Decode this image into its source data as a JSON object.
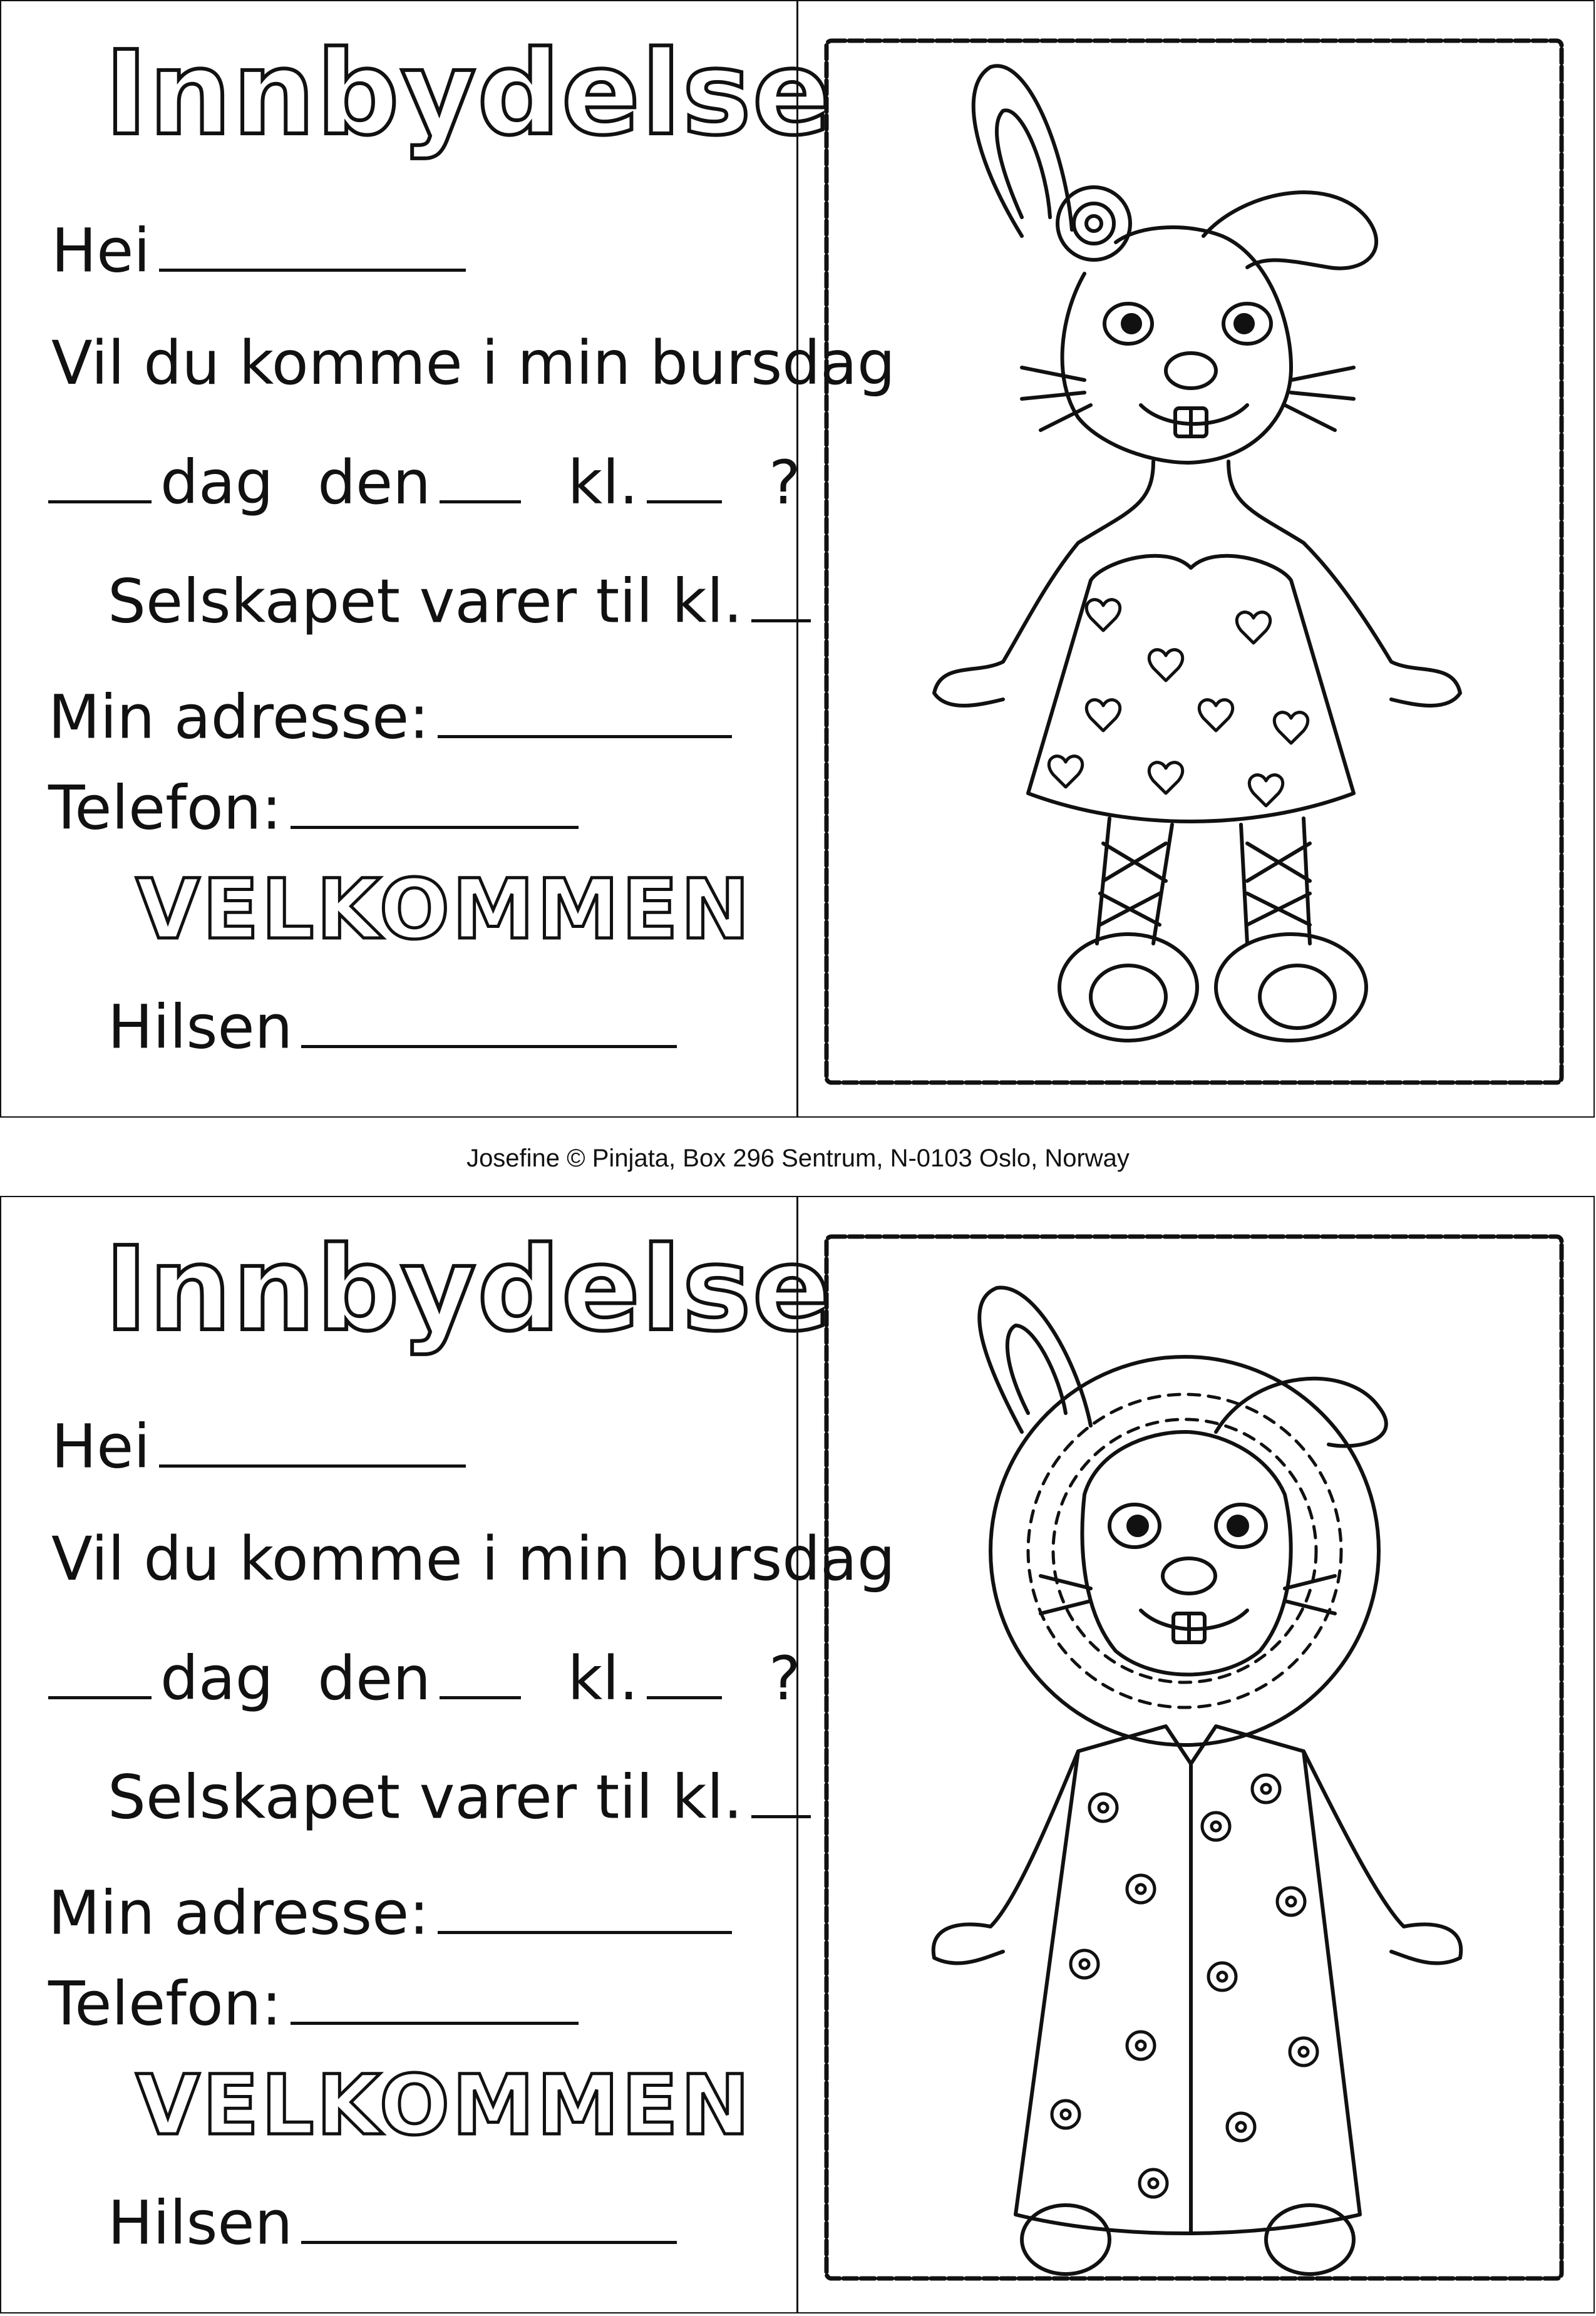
{
  "cards": [
    {
      "title": "Innbydelse",
      "greeting": "Hei",
      "question_line": "Vil du komme i min bursdag",
      "day_word": "dag",
      "date_word": "den",
      "time_word": "kl.",
      "question_mark": "?",
      "duration_line": "Selskapet varer til kl.",
      "address_label": "Min adresse:",
      "phone_label": "Telefon:",
      "welcome": "VELKOMMEN",
      "signoff": "Hilsen"
    },
    {
      "title": "Innbydelse",
      "greeting": "Hei",
      "question_line": "Vil du komme i min bursdag",
      "day_word": "dag",
      "date_word": "den",
      "time_word": "kl.",
      "question_mark": "?",
      "duration_line": "Selskapet varer til kl.",
      "address_label": "Min adresse:",
      "phone_label": "Telefon:",
      "welcome": "VELKOMMEN",
      "signoff": "Hilsen"
    }
  ],
  "footer": "Josefine © Pinjata, Box 296 Sentrum, N-0103 Oslo, Norway"
}
